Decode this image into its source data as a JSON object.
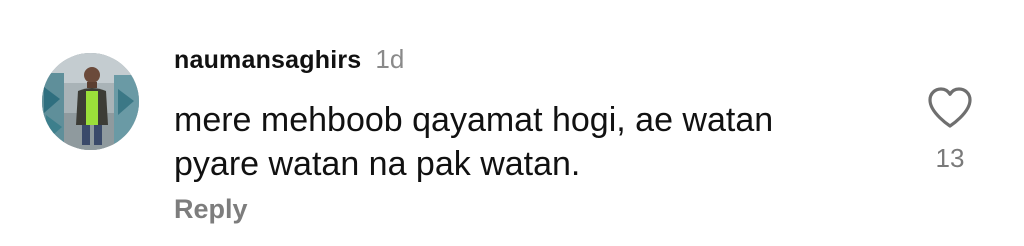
{
  "comment": {
    "username": "naumansaghirs",
    "timestamp": "1d",
    "text_lines": [
      "mere mehboob qayamat hogi, ae watan",
      "pyare watan na pak watan."
    ],
    "reply_label": "Reply",
    "like_count": "13",
    "like_icon": "heart-outline-icon"
  },
  "colors": {
    "text": "#111111",
    "muted": "#8a8a8a",
    "icon": "#6f6f6f"
  }
}
